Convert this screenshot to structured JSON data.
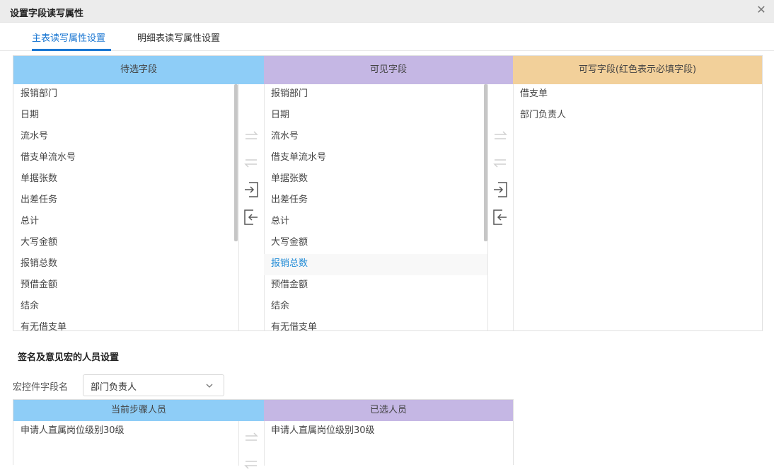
{
  "dialog": {
    "title": "设置字段读写属性",
    "close_glyph": "✕"
  },
  "tabs": [
    {
      "label": "主表读写属性设置",
      "active": true
    },
    {
      "label": "明细表读写属性设置",
      "active": false
    }
  ],
  "fields": {
    "candidate": {
      "header": "待选字段",
      "items": [
        "报销部门",
        "日期",
        "流水号",
        "借支单流水号",
        "单据张数",
        "出差任务",
        "总计",
        "大写金额",
        "报销总数",
        "预借金额",
        "结余",
        "有无借支单"
      ]
    },
    "visible": {
      "header": "可见字段",
      "items": [
        "报销部门",
        "日期",
        "流水号",
        "借支单流水号",
        "单据张数",
        "出差任务",
        "总计",
        "大写金额",
        "报销总数",
        "预借金额",
        "结余",
        "有无借支单"
      ],
      "highlighted_index": 8
    },
    "writable": {
      "header": "可写字段(红色表示必填字段)",
      "items": [
        "借支单",
        "部门负责人"
      ]
    }
  },
  "signature": {
    "section_title": "签名及意见宏的人员设置",
    "macro_label": "宏控件字段名",
    "macro_value": "部门负责人",
    "current": {
      "header": "当前步骤人员",
      "items": [
        "申请人直属岗位级别30级"
      ]
    },
    "selected": {
      "header": "已选人员",
      "items": [
        "申请人直属岗位级别30级"
      ]
    }
  },
  "colors": {
    "accent": "#1976d2",
    "header_blue": "#8ecdf7",
    "header_purple": "#c5b7e4",
    "header_orange": "#f2d09a",
    "highlight_text": "#1f8ad6"
  },
  "icons": [
    "close-icon",
    "move-all-right-icon",
    "move-all-left-icon",
    "move-right-icon",
    "move-left-icon",
    "chevron-down-icon"
  ]
}
